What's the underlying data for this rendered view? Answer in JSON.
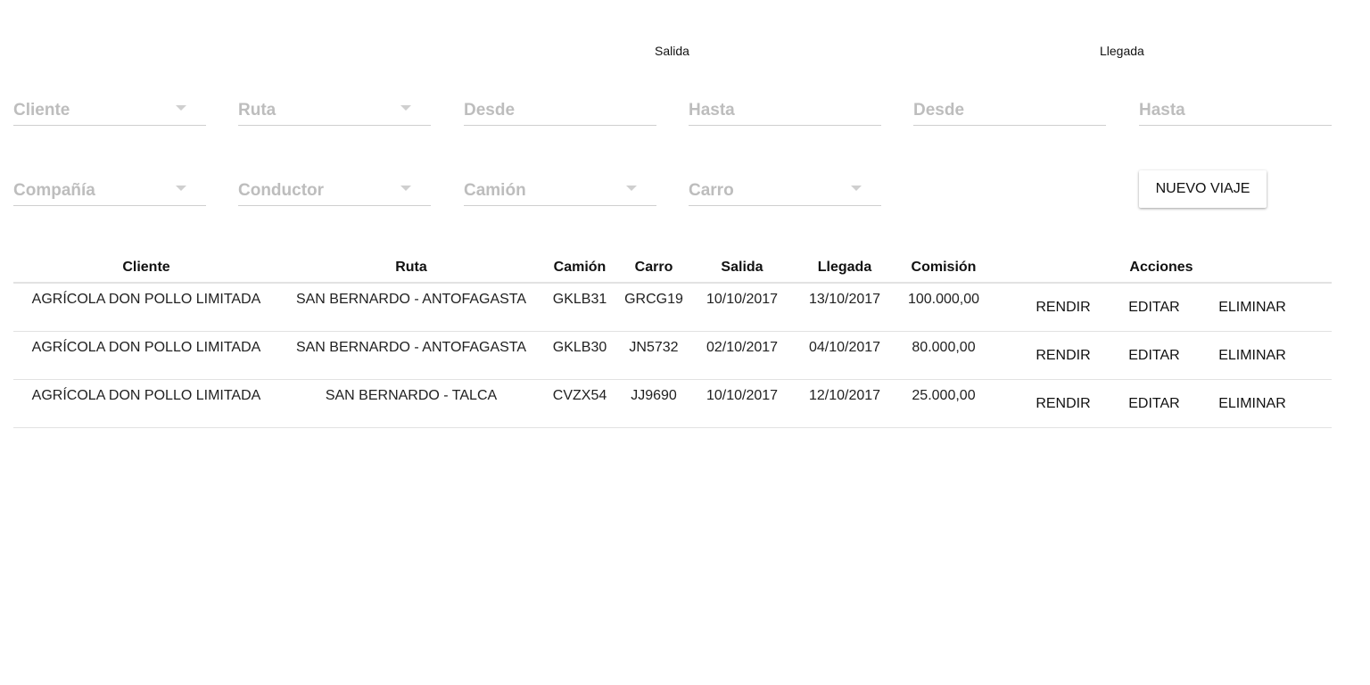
{
  "filters": {
    "salida_label": "Salida",
    "llegada_label": "Llegada",
    "row1": {
      "cliente": "Cliente",
      "ruta": "Ruta",
      "salida_desde": "Desde",
      "salida_hasta": "Hasta",
      "llegada_desde": "Desde",
      "llegada_hasta": "Hasta"
    },
    "row2": {
      "compania": "Compañía",
      "conductor": "Conductor",
      "camion": "Camión",
      "carro": "Carro"
    },
    "new_trip_button": "NUEVO VIAJE"
  },
  "table": {
    "headers": [
      "Cliente",
      "Ruta",
      "Camión",
      "Carro",
      "Salida",
      "Llegada",
      "Comisión",
      "Acciones"
    ],
    "rows": [
      {
        "cliente": "AGRÍCOLA DON POLLO LIMITADA",
        "ruta": "SAN BERNARDO - ANTOFAGASTA",
        "camion": "GKLB31",
        "carro": "GRCG19",
        "salida": "10/10/2017",
        "llegada": "13/10/2017",
        "comision": "100.000,00"
      },
      {
        "cliente": "AGRÍCOLA DON POLLO LIMITADA",
        "ruta": "SAN BERNARDO - ANTOFAGASTA",
        "camion": "GKLB30",
        "carro": "JN5732",
        "salida": "02/10/2017",
        "llegada": "04/10/2017",
        "comision": "80.000,00"
      },
      {
        "cliente": "AGRÍCOLA DON POLLO LIMITADA",
        "ruta": "SAN BERNARDO - TALCA",
        "camion": "CVZX54",
        "carro": "JJ9690",
        "salida": "10/10/2017",
        "llegada": "12/10/2017",
        "comision": "25.000,00"
      }
    ],
    "actions": {
      "rendir": "RENDIR",
      "editar": "EDITAR",
      "eliminar": "ELIMINAR"
    }
  },
  "icons": {
    "dropdown": "chevron-down-icon"
  },
  "colors": {
    "placeholder": "#bdbdbd",
    "underline": "#cfcfcf",
    "divider": "#e2e2e2"
  }
}
